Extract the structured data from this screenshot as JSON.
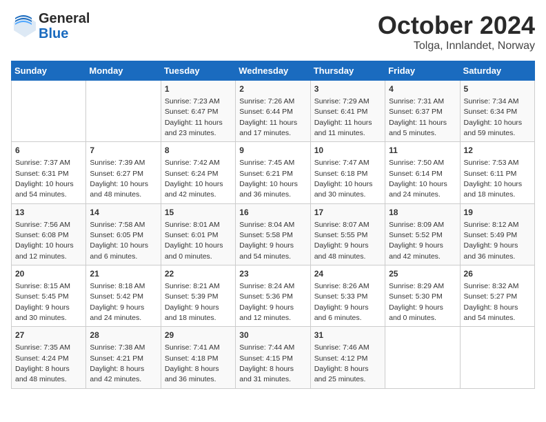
{
  "header": {
    "logo_line1": "General",
    "logo_line2": "Blue",
    "title": "October 2024",
    "subtitle": "Tolga, Innlandet, Norway"
  },
  "calendar": {
    "days_of_week": [
      "Sunday",
      "Monday",
      "Tuesday",
      "Wednesday",
      "Thursday",
      "Friday",
      "Saturday"
    ],
    "weeks": [
      [
        {
          "day": "",
          "sunrise": "",
          "sunset": "",
          "daylight": ""
        },
        {
          "day": "",
          "sunrise": "",
          "sunset": "",
          "daylight": ""
        },
        {
          "day": "1",
          "sunrise": "Sunrise: 7:23 AM",
          "sunset": "Sunset: 6:47 PM",
          "daylight": "Daylight: 11 hours and 23 minutes."
        },
        {
          "day": "2",
          "sunrise": "Sunrise: 7:26 AM",
          "sunset": "Sunset: 6:44 PM",
          "daylight": "Daylight: 11 hours and 17 minutes."
        },
        {
          "day": "3",
          "sunrise": "Sunrise: 7:29 AM",
          "sunset": "Sunset: 6:41 PM",
          "daylight": "Daylight: 11 hours and 11 minutes."
        },
        {
          "day": "4",
          "sunrise": "Sunrise: 7:31 AM",
          "sunset": "Sunset: 6:37 PM",
          "daylight": "Daylight: 11 hours and 5 minutes."
        },
        {
          "day": "5",
          "sunrise": "Sunrise: 7:34 AM",
          "sunset": "Sunset: 6:34 PM",
          "daylight": "Daylight: 10 hours and 59 minutes."
        }
      ],
      [
        {
          "day": "6",
          "sunrise": "Sunrise: 7:37 AM",
          "sunset": "Sunset: 6:31 PM",
          "daylight": "Daylight: 10 hours and 54 minutes."
        },
        {
          "day": "7",
          "sunrise": "Sunrise: 7:39 AM",
          "sunset": "Sunset: 6:27 PM",
          "daylight": "Daylight: 10 hours and 48 minutes."
        },
        {
          "day": "8",
          "sunrise": "Sunrise: 7:42 AM",
          "sunset": "Sunset: 6:24 PM",
          "daylight": "Daylight: 10 hours and 42 minutes."
        },
        {
          "day": "9",
          "sunrise": "Sunrise: 7:45 AM",
          "sunset": "Sunset: 6:21 PM",
          "daylight": "Daylight: 10 hours and 36 minutes."
        },
        {
          "day": "10",
          "sunrise": "Sunrise: 7:47 AM",
          "sunset": "Sunset: 6:18 PM",
          "daylight": "Daylight: 10 hours and 30 minutes."
        },
        {
          "day": "11",
          "sunrise": "Sunrise: 7:50 AM",
          "sunset": "Sunset: 6:14 PM",
          "daylight": "Daylight: 10 hours and 24 minutes."
        },
        {
          "day": "12",
          "sunrise": "Sunrise: 7:53 AM",
          "sunset": "Sunset: 6:11 PM",
          "daylight": "Daylight: 10 hours and 18 minutes."
        }
      ],
      [
        {
          "day": "13",
          "sunrise": "Sunrise: 7:56 AM",
          "sunset": "Sunset: 6:08 PM",
          "daylight": "Daylight: 10 hours and 12 minutes."
        },
        {
          "day": "14",
          "sunrise": "Sunrise: 7:58 AM",
          "sunset": "Sunset: 6:05 PM",
          "daylight": "Daylight: 10 hours and 6 minutes."
        },
        {
          "day": "15",
          "sunrise": "Sunrise: 8:01 AM",
          "sunset": "Sunset: 6:01 PM",
          "daylight": "Daylight: 10 hours and 0 minutes."
        },
        {
          "day": "16",
          "sunrise": "Sunrise: 8:04 AM",
          "sunset": "Sunset: 5:58 PM",
          "daylight": "Daylight: 9 hours and 54 minutes."
        },
        {
          "day": "17",
          "sunrise": "Sunrise: 8:07 AM",
          "sunset": "Sunset: 5:55 PM",
          "daylight": "Daylight: 9 hours and 48 minutes."
        },
        {
          "day": "18",
          "sunrise": "Sunrise: 8:09 AM",
          "sunset": "Sunset: 5:52 PM",
          "daylight": "Daylight: 9 hours and 42 minutes."
        },
        {
          "day": "19",
          "sunrise": "Sunrise: 8:12 AM",
          "sunset": "Sunset: 5:49 PM",
          "daylight": "Daylight: 9 hours and 36 minutes."
        }
      ],
      [
        {
          "day": "20",
          "sunrise": "Sunrise: 8:15 AM",
          "sunset": "Sunset: 5:45 PM",
          "daylight": "Daylight: 9 hours and 30 minutes."
        },
        {
          "day": "21",
          "sunrise": "Sunrise: 8:18 AM",
          "sunset": "Sunset: 5:42 PM",
          "daylight": "Daylight: 9 hours and 24 minutes."
        },
        {
          "day": "22",
          "sunrise": "Sunrise: 8:21 AM",
          "sunset": "Sunset: 5:39 PM",
          "daylight": "Daylight: 9 hours and 18 minutes."
        },
        {
          "day": "23",
          "sunrise": "Sunrise: 8:24 AM",
          "sunset": "Sunset: 5:36 PM",
          "daylight": "Daylight: 9 hours and 12 minutes."
        },
        {
          "day": "24",
          "sunrise": "Sunrise: 8:26 AM",
          "sunset": "Sunset: 5:33 PM",
          "daylight": "Daylight: 9 hours and 6 minutes."
        },
        {
          "day": "25",
          "sunrise": "Sunrise: 8:29 AM",
          "sunset": "Sunset: 5:30 PM",
          "daylight": "Daylight: 9 hours and 0 minutes."
        },
        {
          "day": "26",
          "sunrise": "Sunrise: 8:32 AM",
          "sunset": "Sunset: 5:27 PM",
          "daylight": "Daylight: 8 hours and 54 minutes."
        }
      ],
      [
        {
          "day": "27",
          "sunrise": "Sunrise: 7:35 AM",
          "sunset": "Sunset: 4:24 PM",
          "daylight": "Daylight: 8 hours and 48 minutes."
        },
        {
          "day": "28",
          "sunrise": "Sunrise: 7:38 AM",
          "sunset": "Sunset: 4:21 PM",
          "daylight": "Daylight: 8 hours and 42 minutes."
        },
        {
          "day": "29",
          "sunrise": "Sunrise: 7:41 AM",
          "sunset": "Sunset: 4:18 PM",
          "daylight": "Daylight: 8 hours and 36 minutes."
        },
        {
          "day": "30",
          "sunrise": "Sunrise: 7:44 AM",
          "sunset": "Sunset: 4:15 PM",
          "daylight": "Daylight: 8 hours and 31 minutes."
        },
        {
          "day": "31",
          "sunrise": "Sunrise: 7:46 AM",
          "sunset": "Sunset: 4:12 PM",
          "daylight": "Daylight: 8 hours and 25 minutes."
        },
        {
          "day": "",
          "sunrise": "",
          "sunset": "",
          "daylight": ""
        },
        {
          "day": "",
          "sunrise": "",
          "sunset": "",
          "daylight": ""
        }
      ]
    ]
  }
}
